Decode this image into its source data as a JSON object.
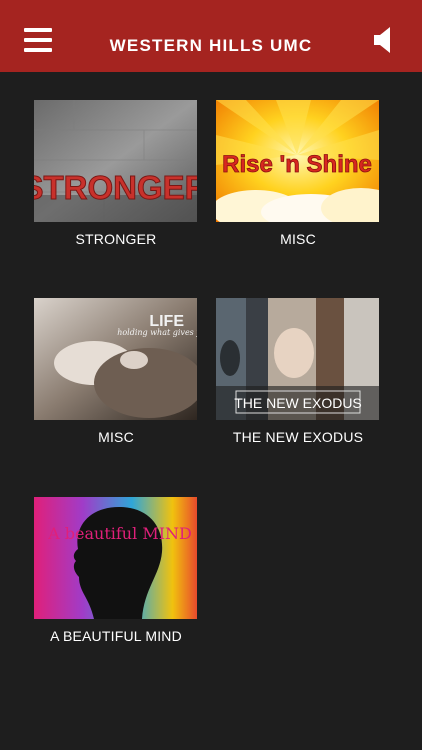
{
  "header": {
    "title": "WESTERN HILLS UMC",
    "menu_icon": "hamburger-menu-icon",
    "audio_icon": "speaker-icon"
  },
  "colors": {
    "header_bg": "#a52420",
    "page_bg": "#1e1e1e",
    "text": "#ffffff"
  },
  "series": [
    {
      "caption": "STRONGER",
      "art_text": "STRONGER"
    },
    {
      "caption": "MISC",
      "art_text": "Rise 'n Shine"
    },
    {
      "caption": "MISC",
      "art_text": "LIFE",
      "art_subtext": "holding what gives you"
    },
    {
      "caption": "THE NEW EXODUS",
      "art_text": "THE NEW EXODUS"
    },
    {
      "caption": "A BEAUTIFUL MIND",
      "art_text": "A beautiful MIND"
    }
  ]
}
